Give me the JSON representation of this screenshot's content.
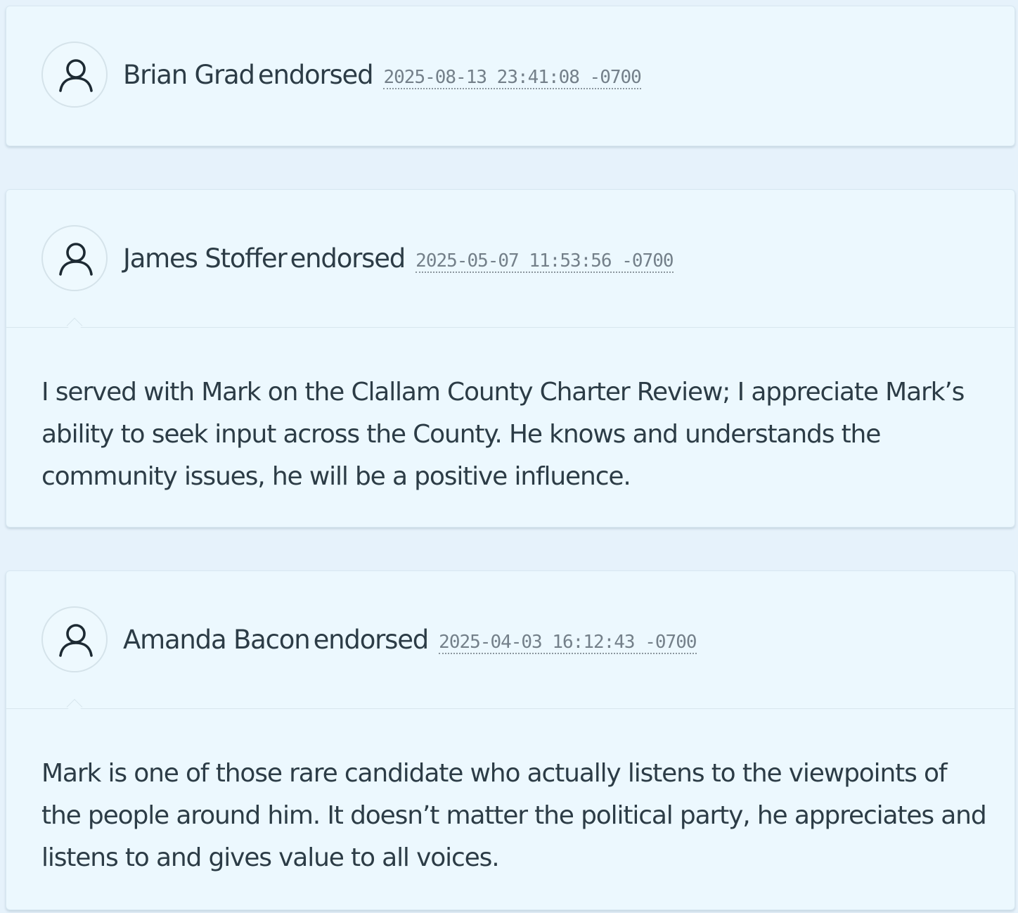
{
  "endorsements": [
    {
      "name": "Brian Grad",
      "action": "endorsed",
      "timestamp": "2025-08-13 23:41:08 -0700",
      "comment": ""
    },
    {
      "name": "James Stoffer",
      "action": "endorsed",
      "timestamp": "2025-05-07 11:53:56 -0700",
      "comment": "I served with Mark on the Clallam County Charter Review; I appreciate Mark’s ability to seek input across the County. He knows and understands the community issues, he will be a positive influence."
    },
    {
      "name": "Amanda Bacon",
      "action": "endorsed",
      "timestamp": "2025-04-03 16:12:43 -0700",
      "comment": "Mark is one of those rare candidate who actually listens to the viewpoints of the people around him. It doesn’t matter the political party, he appreciates and listens to and gives value to all voices."
    }
  ],
  "icons": {
    "avatar": "user-icon"
  },
  "colors": {
    "page_background": "#e6f2fb",
    "card_background": "#ecf8fe",
    "text": "#2c3c46",
    "timestamp": "#74808a"
  }
}
